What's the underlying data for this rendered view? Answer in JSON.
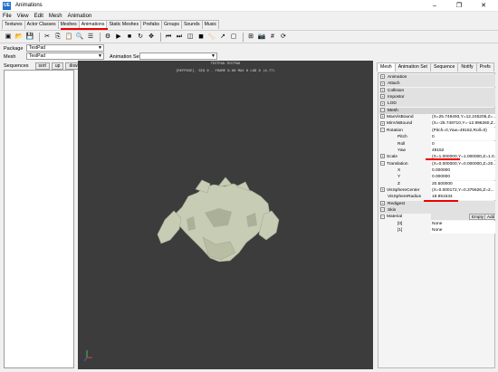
{
  "window": {
    "title": "Animations",
    "app_icon": "UE",
    "minimize": "–",
    "maximize": "❐",
    "close": "✕"
  },
  "menu": [
    "File",
    "View",
    "Edit",
    "Mesh",
    "Animation"
  ],
  "tabs": [
    "Textures",
    "Actor Classes",
    "Meshes",
    "Animations",
    "Static Meshes",
    "Prefabs",
    "Groups",
    "Sounds",
    "Music"
  ],
  "active_tab": "Animations",
  "toolbar_icons": [
    "new-package-icon",
    "open-icon",
    "save-icon",
    "cut-icon",
    "copy-icon",
    "paste-icon",
    "find-icon",
    "properties-icon",
    "tool-icon",
    "play-icon",
    "stop-icon",
    "loop-icon",
    "move-icon",
    "prev-frame-icon",
    "next-frame-icon",
    "wireframe-icon",
    "solid-icon",
    "bone-icon",
    "normals-icon",
    "bounds-icon",
    "lod-icon",
    "camera-icon",
    "grid-icon",
    "refresh-icon"
  ],
  "package": {
    "label": "Package",
    "value": "TestPad"
  },
  "mesh": {
    "label": "Mesh",
    "value": "TestPad"
  },
  "animation_set": {
    "label": "Animation Set",
    "value": ""
  },
  "sequences": {
    "label": "Sequences",
    "sort": "sort",
    "up": "up",
    "down": "down"
  },
  "viewport": {
    "line1": "TESTPAD.TESTPAD",
    "line2": "[REFPOSE]. SEQ 0 .  FRAME 0.00 MAX 0  LOD 0 (4.77)"
  },
  "right_tabs": [
    "Mesh",
    "Animation Set",
    "Sequence",
    "Notify",
    "Prefs"
  ],
  "properties": [
    {
      "type": "cat",
      "exp": "+",
      "name": "Animation"
    },
    {
      "type": "cat",
      "exp": "+",
      "name": "Attach"
    },
    {
      "type": "cat",
      "exp": "+",
      "name": "Collision"
    },
    {
      "type": "cat",
      "exp": "+",
      "name": "Impostor"
    },
    {
      "type": "cat",
      "exp": "+",
      "name": "LOD"
    },
    {
      "type": "cat",
      "exp": "−",
      "name": "Mesh"
    },
    {
      "type": "prop",
      "exp": "+",
      "name": "MaxVisBound",
      "value": "(X=25.748493,Y=12.245205,Z=..."
    },
    {
      "type": "prop",
      "exp": "+",
      "name": "MinVisBound",
      "value": "(X=-25.748710,Y=-12.996260,Z..."
    },
    {
      "type": "prop",
      "exp": "−",
      "name": "Rotation",
      "value": "(Pitch=0,Yaw=49152,Roll=0)"
    },
    {
      "type": "sub",
      "name": "Pitch",
      "value": "0"
    },
    {
      "type": "sub",
      "name": "Roll",
      "value": "0"
    },
    {
      "type": "sub",
      "name": "Yaw",
      "value": "49152"
    },
    {
      "type": "prop",
      "exp": "+",
      "name": "Scale",
      "value": "(X=1.000000,Y=1.000000,Z=1.0..."
    },
    {
      "type": "prop",
      "exp": "−",
      "name": "Translation",
      "value": "(X=0.000000,Y=0.000000,Z=20..."
    },
    {
      "type": "sub",
      "name": "X",
      "value": "0.000000"
    },
    {
      "type": "sub",
      "name": "Y",
      "value": "0.000000"
    },
    {
      "type": "sub",
      "name": "Z",
      "value": "20.500000"
    },
    {
      "type": "prop",
      "exp": "+",
      "name": "VisSphereCenter",
      "value": "(X=0.000172,Y=0.375626,Z=2..."
    },
    {
      "type": "prop",
      "exp": "",
      "name": "VisSphereRadius",
      "value": "18.951534"
    },
    {
      "type": "cat",
      "exp": "+",
      "name": "Redigest"
    },
    {
      "type": "cat",
      "exp": "−",
      "name": "Skin"
    },
    {
      "type": "prop",
      "exp": "−",
      "name": "Material",
      "value": "",
      "empty": "Empty",
      "add": "Add"
    },
    {
      "type": "sub",
      "name": "[0]",
      "value": "None"
    },
    {
      "type": "sub",
      "name": "[1]",
      "value": "None"
    }
  ],
  "colors": {
    "viewport_bg": "#3c3c3c",
    "mesh_fill": "#c7ccb4",
    "highlight_red": "#e00000",
    "accent_blue": "#1e6fd0"
  }
}
